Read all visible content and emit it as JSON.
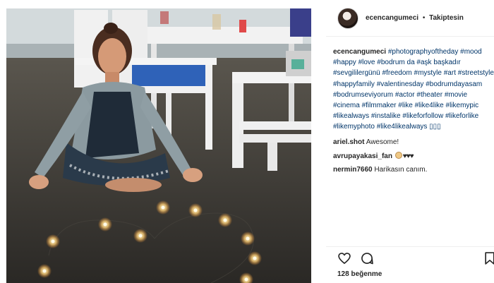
{
  "post": {
    "author": "ecencangumeci",
    "follow_status": "Takiptesin",
    "separator": "•",
    "caption": {
      "username": "ecencangumeci",
      "text": "#photographyoftheday #mood #happy #love #bodrum da #aşk başkadır #sevgililergünü #freedom #mystyle #art #streetstyle #happyfamily #valentinesday #bodrumdayasam #bodrumseviyorum #actor #theater #movie #cinema #filmmaker #like #like4like #likemypic #likealways #instalike #likeforfollow #likeforlike #likemyphoto #like4likealways ▯▯▯"
    },
    "comments": [
      {
        "username": "ariel.shot",
        "text": "Awesome!"
      },
      {
        "username": "avrupayakasi_fan",
        "emoji": "🙌",
        "text": "♥♥♥"
      },
      {
        "username": "nermin7660",
        "text": "Harikasın canım."
      }
    ],
    "likes": "128 beğenme"
  },
  "icons": {
    "like": "heart-icon",
    "comment": "comment-icon",
    "save": "bookmark-icon"
  },
  "colors": {
    "hashtag": "#003569",
    "text": "#262626",
    "divider": "#efefef"
  }
}
